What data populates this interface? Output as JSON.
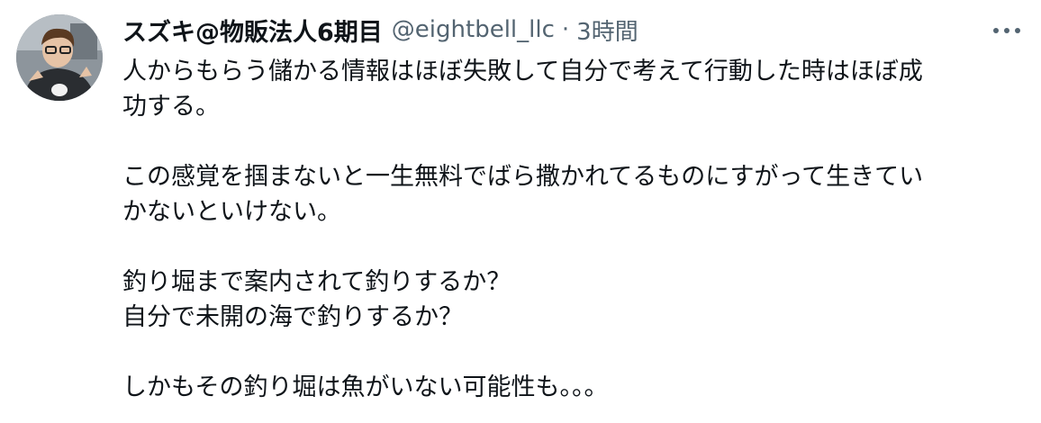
{
  "tweet": {
    "display_name": "スズキ@物販法人6期目",
    "handle": "@eightbell_llc",
    "separator": "·",
    "timestamp": "3時間",
    "paragraphs": [
      [
        "人からもらう儲かる情報はほぼ失敗して自分で考えて行動した時はほぼ成",
        "功する。"
      ],
      [
        "この感覚を掴まないと一生無料でばら撒かれてるものにすがって生きてい",
        "かないといけない。"
      ],
      [
        "釣り堀まで案内されて釣りするか？",
        "自分で未開の海で釣りするか？"
      ],
      [
        "しかもその釣り堀は魚がいない可能性も。。。"
      ]
    ]
  },
  "icons": {
    "avatar": "avatar-photo",
    "more": "more-icon"
  },
  "colors": {
    "text_primary": "#0f1419",
    "text_secondary": "#536471",
    "background": "#ffffff"
  }
}
